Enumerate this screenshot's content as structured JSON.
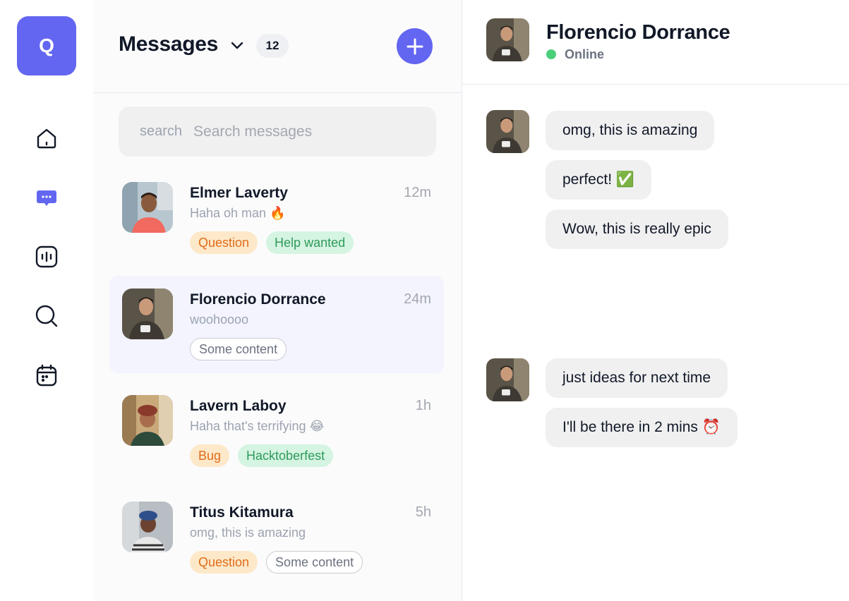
{
  "rail": {
    "logo_letter": "Q",
    "accent": "#6366f1",
    "items": [
      {
        "icon": "home-icon"
      },
      {
        "icon": "chat-icon"
      },
      {
        "icon": "audio-wave-icon"
      },
      {
        "icon": "search-icon"
      },
      {
        "icon": "calendar-icon"
      }
    ]
  },
  "messages": {
    "title": "Messages",
    "count": "12",
    "search": {
      "label": "search",
      "placeholder": "Search messages"
    },
    "conversations": [
      {
        "name": "Elmer Laverty",
        "time": "12m",
        "preview": "Haha oh man 🔥",
        "tags": [
          "Question",
          "Help wanted"
        ]
      },
      {
        "name": "Florencio Dorrance",
        "time": "24m",
        "preview": "woohoooo",
        "tags": [
          "Some content"
        ]
      },
      {
        "name": "Lavern Laboy",
        "time": "1h",
        "preview": "Haha that's terrifying 😂",
        "tags": [
          "Bug",
          "Hacktoberfest"
        ]
      },
      {
        "name": "Titus Kitamura",
        "time": "5h",
        "preview": "omg, this is amazing",
        "tags": [
          "Question",
          "Some content"
        ]
      }
    ]
  },
  "chat": {
    "contact_name": "Florencio Dorrance",
    "status": "Online",
    "status_color": "#4ccf7a",
    "group1": [
      "omg, this is amazing",
      "perfect! ✅",
      "Wow, this is really epic"
    ],
    "group2": [
      "just ideas for next time",
      "I'll be there in 2 mins ⏰"
    ]
  }
}
